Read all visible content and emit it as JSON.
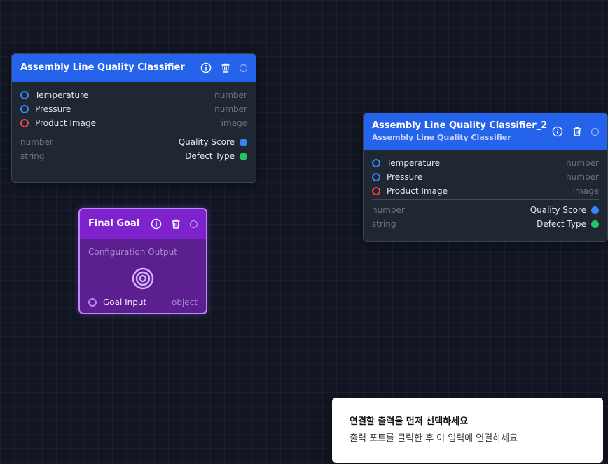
{
  "nodes": [
    {
      "title": "Assembly Line Quality Classifier",
      "subtitle": "",
      "inputs": [
        {
          "label": "Temperature",
          "type": "number",
          "color": "#3b82f6"
        },
        {
          "label": "Pressure",
          "type": "number",
          "color": "#3b82f6"
        },
        {
          "label": "Product Image",
          "type": "image",
          "color": "#ef4444"
        }
      ],
      "outputs": [
        {
          "label": "Quality Score",
          "type": "number",
          "color": "#3b82f6"
        },
        {
          "label": "Defect Type",
          "type": "string",
          "color": "#22c55e"
        }
      ]
    },
    {
      "title": "Assembly Line Quality Classifier_2",
      "subtitle": "Assembly Line Quality Classifier",
      "inputs": [
        {
          "label": "Temperature",
          "type": "number",
          "color": "#3b82f6"
        },
        {
          "label": "Pressure",
          "type": "number",
          "color": "#3b82f6"
        },
        {
          "label": "Product Image",
          "type": "image",
          "color": "#ef4444"
        }
      ],
      "outputs": [
        {
          "label": "Quality Score",
          "type": "number",
          "color": "#3b82f6"
        },
        {
          "label": "Defect Type",
          "type": "string",
          "color": "#22c55e"
        }
      ]
    }
  ],
  "goal": {
    "title": "Final Goal",
    "caption": "Configuration Output",
    "input_label": "Goal Input",
    "input_type": "object"
  },
  "icons": {
    "info": "info-icon",
    "delete": "trash-icon",
    "status": "status-ring-icon",
    "goal": "target-icon"
  },
  "toast": {
    "title": "연결할 출력을 먼저 선택하세요",
    "message": "출력 포트를 클릭한 후 이 입력에 연결하세요"
  }
}
